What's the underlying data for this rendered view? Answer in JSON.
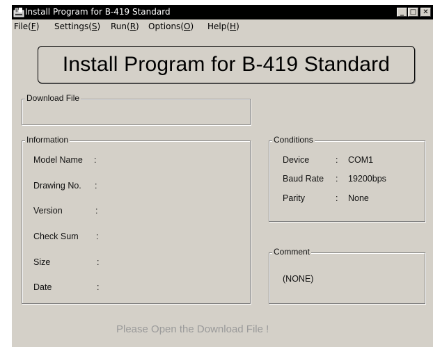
{
  "window": {
    "title": "Install Program for B-419 Standard",
    "icon": "install-program-icon",
    "controls": {
      "minimize": "_",
      "maximize": "□",
      "close": "✕"
    }
  },
  "menu": [
    {
      "label": "File",
      "hotkey": "F"
    },
    {
      "label": "Settings",
      "hotkey": "S"
    },
    {
      "label": "Run",
      "hotkey": "R"
    },
    {
      "label": "Options",
      "hotkey": "O"
    },
    {
      "label": "Help",
      "hotkey": "H"
    }
  ],
  "banner": {
    "title": "Install Program for B-419 Standard"
  },
  "download_file": {
    "label": "Download File",
    "value": ""
  },
  "information": {
    "label": "Information",
    "rows": [
      {
        "label": "Model Name",
        "value": ""
      },
      {
        "label": "Drawing No.",
        "value": ""
      },
      {
        "label": "Version",
        "value": ""
      },
      {
        "label": "Check Sum",
        "value": ""
      },
      {
        "label": "Size",
        "value": ""
      },
      {
        "label": "Date",
        "value": ""
      }
    ]
  },
  "conditions": {
    "label": "Conditions",
    "rows": [
      {
        "label": "Device",
        "value": "COM1"
      },
      {
        "label": "Baud Rate",
        "value": "19200bps"
      },
      {
        "label": "Parity",
        "value": "None"
      }
    ]
  },
  "comment": {
    "label": "Comment",
    "value": "(NONE)"
  },
  "status": {
    "message": "Please Open the Download File !"
  },
  "colors": {
    "face": "#d4d0c8",
    "titlebar": "#000000",
    "status_text": "#9a9a9a"
  }
}
